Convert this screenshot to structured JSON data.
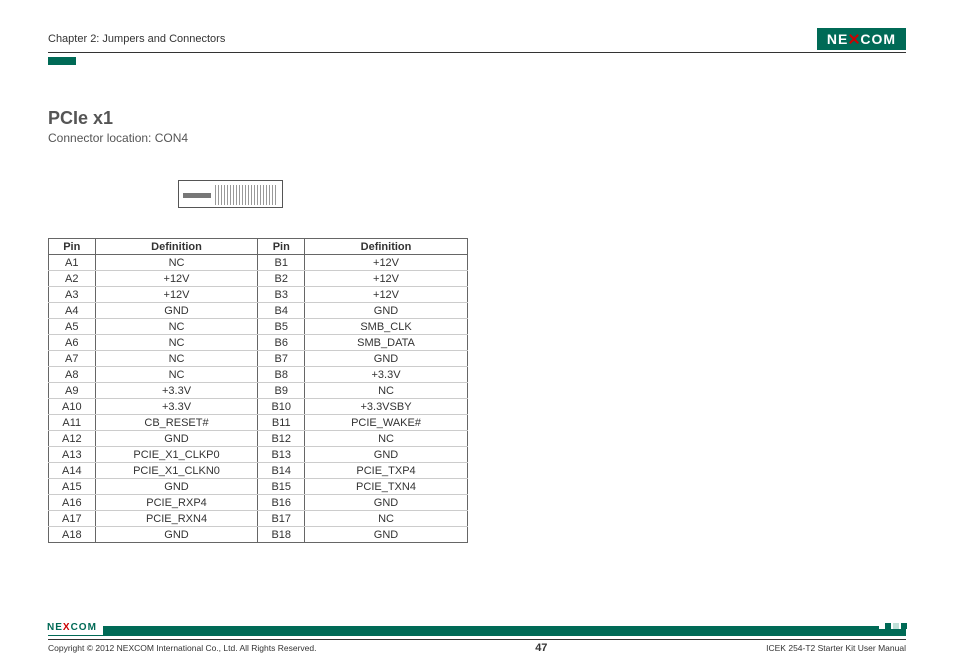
{
  "header": {
    "chapter": "Chapter 2: Jumpers and Connectors",
    "brand_left": "NE",
    "brand_right": "COM"
  },
  "section": {
    "title": "PCIe x1",
    "subtitle": "Connector location: CON4"
  },
  "table": {
    "headers": [
      "Pin",
      "Definition",
      "Pin",
      "Definition"
    ],
    "rows": [
      [
        "A1",
        "NC",
        "B1",
        "+12V"
      ],
      [
        "A2",
        "+12V",
        "B2",
        "+12V"
      ],
      [
        "A3",
        "+12V",
        "B3",
        "+12V"
      ],
      [
        "A4",
        "GND",
        "B4",
        "GND"
      ],
      [
        "A5",
        "NC",
        "B5",
        "SMB_CLK"
      ],
      [
        "A6",
        "NC",
        "B6",
        "SMB_DATA"
      ],
      [
        "A7",
        "NC",
        "B7",
        "GND"
      ],
      [
        "A8",
        "NC",
        "B8",
        "+3.3V"
      ],
      [
        "A9",
        "+3.3V",
        "B9",
        "NC"
      ],
      [
        "A10",
        "+3.3V",
        "B10",
        "+3.3VSBY"
      ],
      [
        "A11",
        "CB_RESET#",
        "B11",
        "PCIE_WAKE#"
      ],
      [
        "A12",
        "GND",
        "B12",
        "NC"
      ],
      [
        "A13",
        "PCIE_X1_CLKP0",
        "B13",
        "GND"
      ],
      [
        "A14",
        "PCIE_X1_CLKN0",
        "B14",
        "PCIE_TXP4"
      ],
      [
        "A15",
        "GND",
        "B15",
        "PCIE_TXN4"
      ],
      [
        "A16",
        "PCIE_RXP4",
        "B16",
        "GND"
      ],
      [
        "A17",
        "PCIE_RXN4",
        "B17",
        "NC"
      ],
      [
        "A18",
        "GND",
        "B18",
        "GND"
      ]
    ]
  },
  "footer": {
    "copyright": "Copyright © 2012 NEXCOM International Co., Ltd. All Rights Reserved.",
    "page": "47",
    "doc": "ICEK 254-T2 Starter Kit User Manual",
    "mini_left": "NE",
    "mini_x": "X",
    "mini_right": "COM"
  }
}
